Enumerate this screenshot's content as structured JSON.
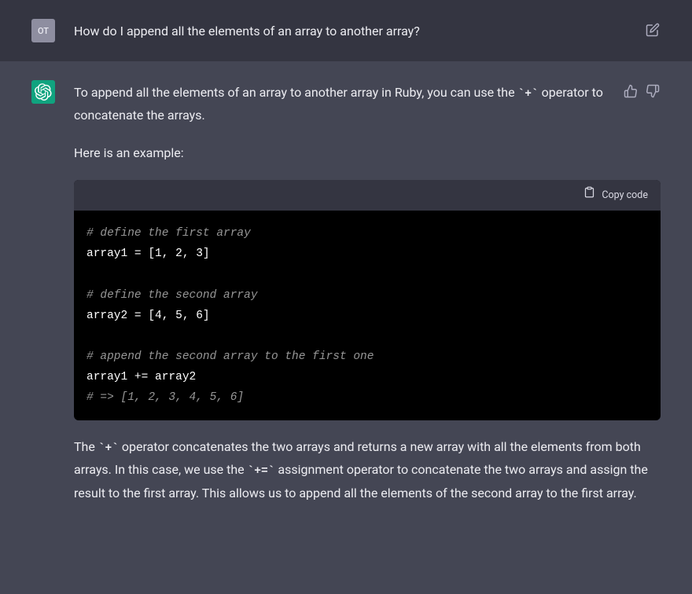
{
  "user": {
    "avatar_initials": "OT",
    "prompt": "How do I append all the elements of an array to another array?"
  },
  "assistant": {
    "para1_prefix": "To append all the elements of an array to another array in Ruby, you can use the ",
    "para1_code": "`+`",
    "para1_suffix": " operator to concatenate the arrays.",
    "para2": "Here is an example:",
    "code_copy_label": "Copy code",
    "code": {
      "l1": "# define the first array",
      "l2": "array1 = [1, 2, 3]",
      "l3": "",
      "l4": "# define the second array",
      "l5": "array2 = [4, 5, 6]",
      "l6": "",
      "l7": "# append the second array to the first one",
      "l8": "array1 += array2",
      "l9": "# => [1, 2, 3, 4, 5, 6]"
    },
    "para3_t1": "The ",
    "para3_c1": "`+`",
    "para3_t2": " operator concatenates the two arrays and returns a new array with all the elements from both arrays. In this case, we use the ",
    "para3_c2": "`+=`",
    "para3_t3": " assignment operator to concatenate the two arrays and assign the result to the first array. This allows us to append all the elements of the second array to the first array."
  }
}
